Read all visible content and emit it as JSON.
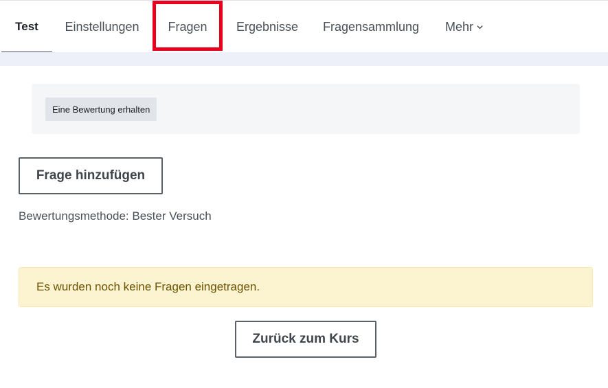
{
  "tabs": [
    {
      "label": "Test",
      "active": true
    },
    {
      "label": "Einstellungen",
      "active": false
    },
    {
      "label": "Fragen",
      "active": false,
      "highlighted": true
    },
    {
      "label": "Ergebnisse",
      "active": false
    },
    {
      "label": "Fragensammlung",
      "active": false
    },
    {
      "label": "Mehr",
      "active": false,
      "icon": "chevron-down-icon"
    }
  ],
  "completion": {
    "badge": "Eine Bewertung erhalten"
  },
  "actions": {
    "add_question": "Frage hinzufügen",
    "back_to_course": "Zurück zum Kurs"
  },
  "grading": {
    "method_text": "Bewertungsmethode: Bester Versuch"
  },
  "notice": {
    "text": "Es wurden noch keine Fragen eingetragen."
  },
  "colors": {
    "highlight": "#e8001c",
    "alert_background": "#fcf3d1",
    "alert_text": "#6b5300",
    "stripe": "#edf0f8"
  }
}
